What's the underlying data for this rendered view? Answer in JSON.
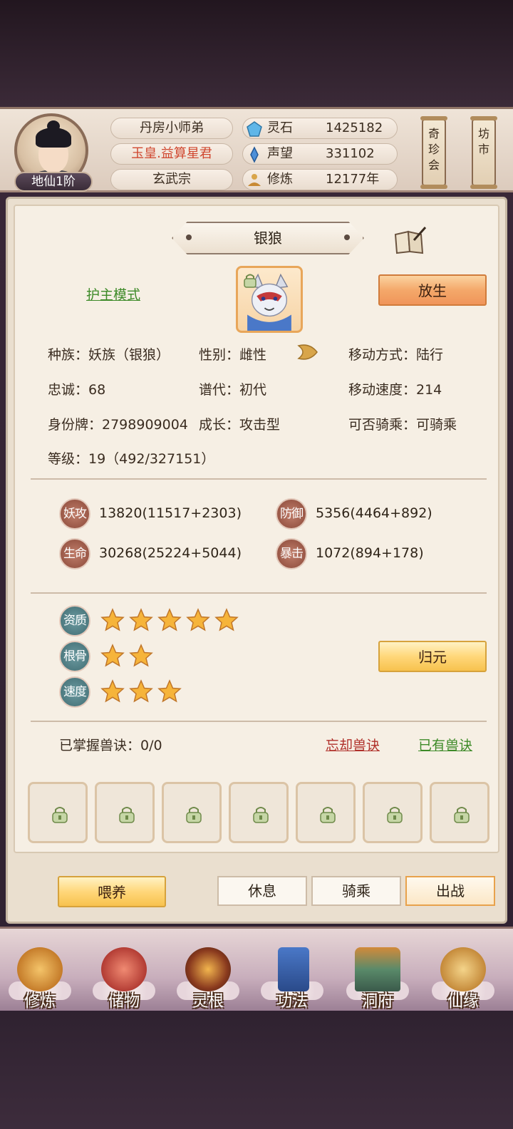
{
  "header": {
    "rank": "地仙1阶",
    "names": [
      "丹房小师弟",
      "玉皇.益算星君",
      "玄武宗"
    ],
    "resources": [
      {
        "label": "灵石",
        "value": "1425182",
        "icon": "spirit-stone-icon"
      },
      {
        "label": "声望",
        "value": "331102",
        "icon": "reputation-icon"
      },
      {
        "label": "修炼",
        "value": "12177年",
        "icon": "meditation-icon"
      }
    ],
    "side_buttons": [
      "奇珍会",
      "坊市"
    ]
  },
  "pet": {
    "name": "银狼",
    "mode_link": "护主模式",
    "release_button": "放生",
    "info": [
      [
        "种族：妖族（银狼）",
        "性别：雌性",
        "移动方式：陆行"
      ],
      [
        "忠诚：68",
        "谱代：初代",
        "移动速度：214"
      ],
      [
        "身份牌：2798909004",
        "成长：攻击型",
        "可否骑乘：可骑乘"
      ],
      [
        "等级：19（492/327151）",
        "",
        ""
      ]
    ],
    "stats": [
      {
        "label": "妖攻",
        "value": "13820(11517+2303)"
      },
      {
        "label": "防御",
        "value": "5356(4464+892)"
      },
      {
        "label": "生命",
        "value": "30268(25224+5044)"
      },
      {
        "label": "暴击",
        "value": "1072(894+178)"
      }
    ],
    "ratings": [
      {
        "label": "资质",
        "stars": 5
      },
      {
        "label": "根骨",
        "stars": 2
      },
      {
        "label": "速度",
        "stars": 3
      }
    ],
    "reset_button": "归元",
    "skills_label": "已掌握兽诀：0/0",
    "forget_link": "忘却兽诀",
    "owned_link": "已有兽诀",
    "slot_count": 7
  },
  "actions": {
    "feed": "喂养",
    "rest": "休息",
    "ride": "骑乘",
    "battle": "出战"
  },
  "nav": [
    "修炼",
    "储物",
    "灵根",
    "功法",
    "洞府",
    "仙缘"
  ],
  "colors": {
    "accent_orange": "#e87a2a",
    "link_green": "#3d8a28",
    "link_red": "#b0302a",
    "title_red": "#d04830"
  }
}
